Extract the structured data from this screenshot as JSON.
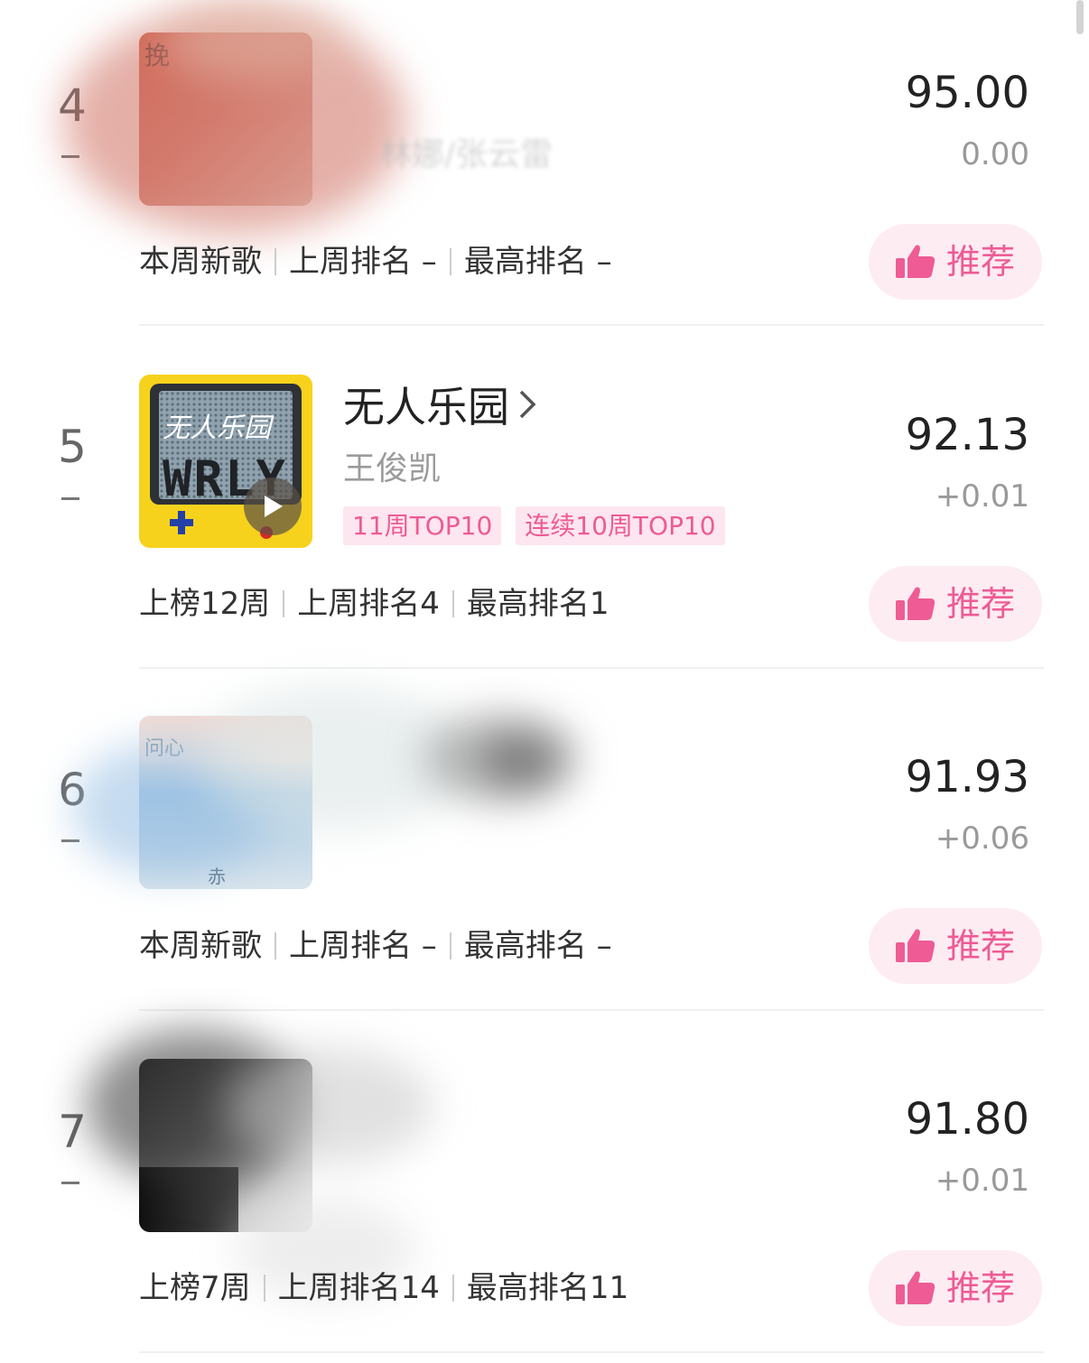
{
  "entries": [
    {
      "rank": "4",
      "title": "",
      "artist": "林娜/张云雷",
      "cover_text": "挽",
      "score": "95.00",
      "delta": "0.00",
      "tags": [],
      "meta": [
        "本周新歌",
        "上周排名 –",
        "最高排名 –"
      ],
      "recommend_label": "推荐",
      "blurred": true
    },
    {
      "rank": "5",
      "title": "无人乐园",
      "artist": "王俊凯",
      "cover_title": "无人乐园",
      "cover_text": "WRLY",
      "score": "92.13",
      "delta": "+0.01",
      "tags": [
        "11周TOP10",
        "连续10周TOP10"
      ],
      "meta": [
        "上榜12周",
        "上周排名4",
        "最高排名1"
      ],
      "recommend_label": "推荐",
      "blurred": false
    },
    {
      "rank": "6",
      "title": "",
      "artist": "",
      "cover_text": "问心",
      "cover_text2": "赤",
      "score": "91.93",
      "delta": "+0.06",
      "tags": [],
      "meta": [
        "本周新歌",
        "上周排名 –",
        "最高排名 –"
      ],
      "recommend_label": "推荐",
      "blurred": true
    },
    {
      "rank": "7",
      "title": "",
      "artist": "",
      "score": "91.80",
      "delta": "+0.01",
      "tags": [],
      "meta": [
        "上榜7周",
        "上周排名14",
        "最高排名11"
      ],
      "recommend_label": "推荐",
      "blurred": true
    }
  ],
  "colors": {
    "accent_pink": "#ee5b95",
    "button_bg": "#fdecf2",
    "tag_bg": "#fde6ef",
    "cover_yellow": "#f7d21c"
  },
  "icons": {
    "recommend": "thumbs-up-icon",
    "play": "play-icon",
    "chevron": "chevron-right-icon",
    "trend": "no-change-dash-icon"
  }
}
